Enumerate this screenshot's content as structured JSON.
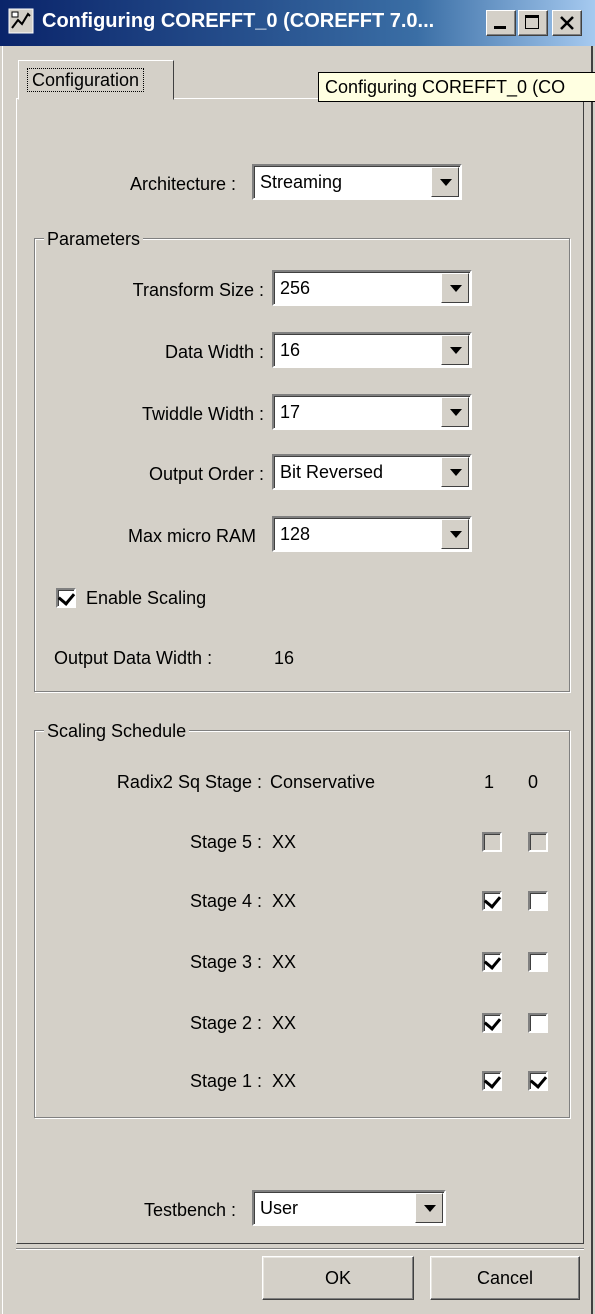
{
  "window": {
    "title": "Configuring COREFFT_0 (COREFFT 7.0...",
    "tooltip": "Configuring COREFFT_0 (CO"
  },
  "tabs": [
    {
      "label": "Configuration",
      "active": true
    }
  ],
  "architecture": {
    "label": "Architecture :",
    "value": "Streaming"
  },
  "parameters": {
    "title": "Parameters",
    "transform_size": {
      "label": "Transform Size :",
      "value": "256"
    },
    "data_width": {
      "label": "Data Width :",
      "value": "16"
    },
    "twiddle_width": {
      "label": "Twiddle Width :",
      "value": "17"
    },
    "output_order": {
      "label": "Output Order :",
      "value": "Bit Reversed"
    },
    "max_micro_ram": {
      "label": "Max micro RAM",
      "value": "128"
    },
    "enable_scaling": {
      "label": "Enable Scaling",
      "checked": true
    },
    "output_data_width": {
      "label": "Output Data Width :",
      "value": "16"
    }
  },
  "scaling_schedule": {
    "title": "Scaling Schedule",
    "header": {
      "label": "Radix2 Sq Stage :",
      "value": "Conservative",
      "col1": "1",
      "col0": "0"
    },
    "stages": [
      {
        "label": "Stage 5 :",
        "value": "XX",
        "bit1": false,
        "bit0": false,
        "enabled": false
      },
      {
        "label": "Stage 4 :",
        "value": "XX",
        "bit1": true,
        "bit0": false,
        "enabled": true
      },
      {
        "label": "Stage 3 :",
        "value": "XX",
        "bit1": true,
        "bit0": false,
        "enabled": true
      },
      {
        "label": "Stage 2 :",
        "value": "XX",
        "bit1": true,
        "bit0": false,
        "enabled": true
      },
      {
        "label": "Stage 1 :",
        "value": "XX",
        "bit1": true,
        "bit0": true,
        "enabled": true
      }
    ]
  },
  "testbench": {
    "label": "Testbench :",
    "value": "User"
  },
  "buttons": {
    "ok": "OK",
    "cancel": "Cancel"
  },
  "colors": {
    "titlebar": "#0a246a",
    "face": "#d4d0c8",
    "tooltip": "#ffffe1"
  }
}
